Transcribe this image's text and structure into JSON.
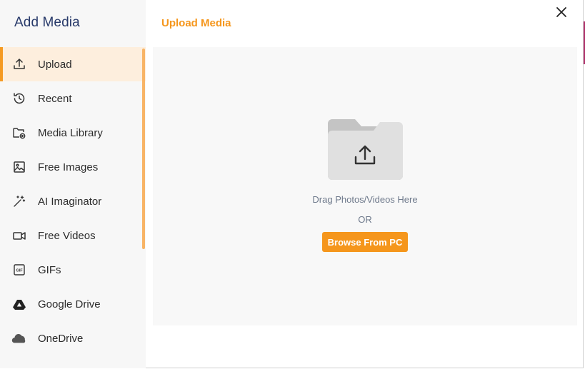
{
  "sidebar": {
    "title": "Add Media",
    "items": [
      {
        "label": "Upload",
        "icon": "upload-icon",
        "active": true
      },
      {
        "label": "Recent",
        "icon": "history-icon"
      },
      {
        "label": "Media Library",
        "icon": "media-library-icon"
      },
      {
        "label": "Free Images",
        "icon": "image-icon"
      },
      {
        "label": "AI Imaginator",
        "icon": "magic-wand-icon"
      },
      {
        "label": "Free Videos",
        "icon": "video-camera-icon"
      },
      {
        "label": "GIFs",
        "icon": "gif-icon"
      },
      {
        "label": "Google Drive",
        "icon": "google-drive-icon"
      },
      {
        "label": "OneDrive",
        "icon": "onedrive-icon"
      }
    ]
  },
  "main": {
    "title": "Upload Media",
    "drag_text": "Drag Photos/Videos Here",
    "or_text": "OR",
    "browse_label": "Browse From PC"
  },
  "colors": {
    "accent": "#f5961c",
    "active_bg": "#fdeedd",
    "title": "#283a6a"
  }
}
